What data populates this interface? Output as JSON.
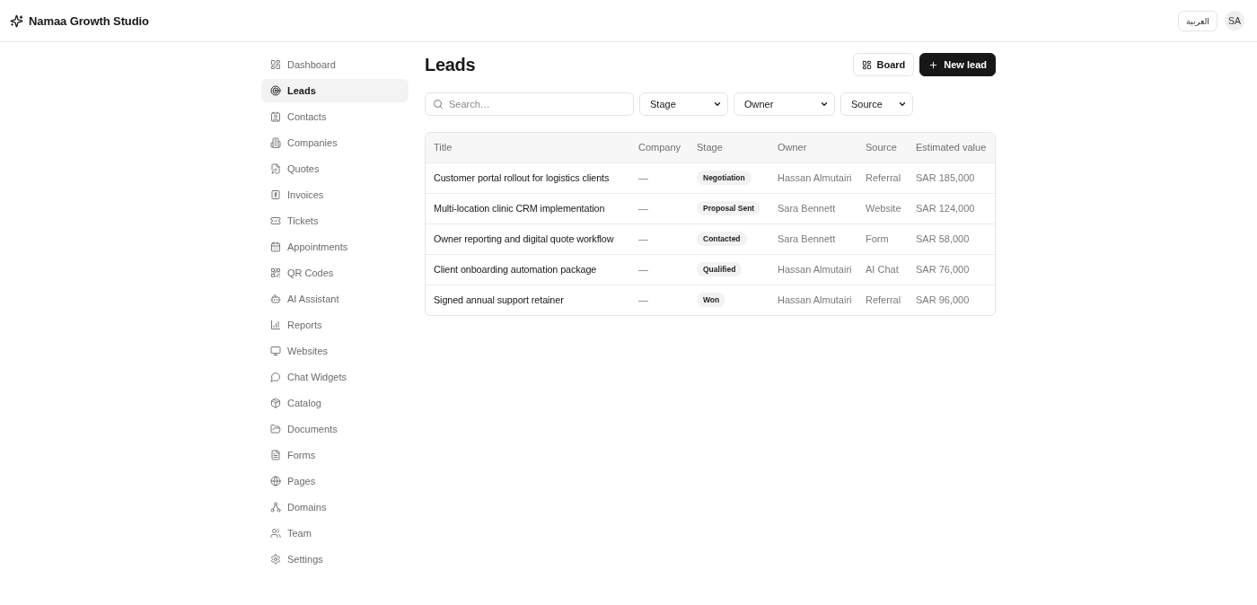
{
  "header": {
    "brand": "Namaa Growth Studio",
    "language_button": "العربية",
    "avatar": "SA"
  },
  "sidebar": {
    "items": [
      {
        "label": "Dashboard",
        "selected": false
      },
      {
        "label": "Leads",
        "selected": true
      },
      {
        "label": "Contacts",
        "selected": false
      },
      {
        "label": "Companies",
        "selected": false
      },
      {
        "label": "Quotes",
        "selected": false
      },
      {
        "label": "Invoices",
        "selected": false
      },
      {
        "label": "Tickets",
        "selected": false
      },
      {
        "label": "Appointments",
        "selected": false
      },
      {
        "label": "QR Codes",
        "selected": false
      },
      {
        "label": "AI Assistant",
        "selected": false
      },
      {
        "label": "Reports",
        "selected": false
      },
      {
        "label": "Websites",
        "selected": false
      },
      {
        "label": "Chat Widgets",
        "selected": false
      },
      {
        "label": "Catalog",
        "selected": false
      },
      {
        "label": "Documents",
        "selected": false
      },
      {
        "label": "Forms",
        "selected": false
      },
      {
        "label": "Pages",
        "selected": false
      },
      {
        "label": "Domains",
        "selected": false
      },
      {
        "label": "Team",
        "selected": false
      },
      {
        "label": "Settings",
        "selected": false
      }
    ]
  },
  "main": {
    "title": "Leads",
    "actions": [
      {
        "label": "Board",
        "kind": "secondary"
      },
      {
        "label": "New lead",
        "kind": "primary"
      }
    ],
    "filters": {
      "search": {
        "placeholder": "Search…"
      },
      "selects": [
        {
          "value": "Stage"
        },
        {
          "value": "Owner"
        },
        {
          "value": "Source"
        }
      ]
    },
    "table": {
      "columns": [
        "Title",
        "Company",
        "Stage",
        "Owner",
        "Source",
        "Estimated value"
      ],
      "rows": [
        {
          "title": "Customer portal rollout for logistics clients",
          "company": "—",
          "stage": "Negotiation",
          "owner": "Hassan Almutairi",
          "source": "Referral",
          "estimated_value": "SAR 185,000"
        },
        {
          "title": "Multi-location clinic CRM implementation",
          "company": "—",
          "stage": "Proposal Sent",
          "owner": "Sara Bennett",
          "source": "Website",
          "estimated_value": "SAR 124,000"
        },
        {
          "title": "Owner reporting and digital quote workflow",
          "company": "—",
          "stage": "Contacted",
          "owner": "Sara Bennett",
          "source": "Form",
          "estimated_value": "SAR 58,000"
        },
        {
          "title": "Client onboarding automation package",
          "company": "—",
          "stage": "Qualified",
          "owner": "Hassan Almutairi",
          "source": "AI Chat",
          "estimated_value": "SAR 76,000"
        },
        {
          "title": "Signed annual support retainer",
          "company": "—",
          "stage": "Won",
          "owner": "Hassan Almutairi",
          "source": "Referral",
          "estimated_value": "SAR 96,000"
        }
      ]
    }
  }
}
